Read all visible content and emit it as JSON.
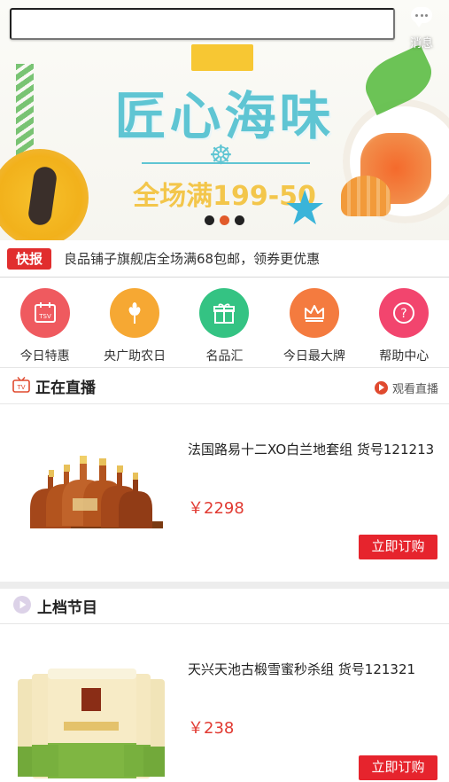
{
  "header": {
    "search_placeholder": "",
    "message_label": "消息"
  },
  "banner": {
    "title": "匠心海味",
    "promo": "全场满199-50",
    "dots": 3,
    "active_dot": 1,
    "colors": {
      "title": "#5fc5d3",
      "promo": "#f3c64b"
    }
  },
  "ticker": {
    "tag": "快报",
    "text": "良品铺子旗舰店全场满68包邮，领券更优惠"
  },
  "categories": [
    {
      "label": "今日特惠",
      "icon": "tsv-calendar-icon",
      "color": "#ef5a5f"
    },
    {
      "label": "央广助农日",
      "icon": "wheat-icon",
      "color": "#f6a833"
    },
    {
      "label": "名品汇",
      "icon": "gift-icon",
      "color": "#34c383"
    },
    {
      "label": "今日最大牌",
      "icon": "crown-icon",
      "color": "#f47b3f"
    },
    {
      "label": "帮助中心",
      "icon": "help-icon",
      "color": "#f2456e"
    }
  ],
  "live": {
    "title": "正在直播",
    "watch_label": "观看直播",
    "product": {
      "name": "法国路易十二XO白兰地套组 货号121213",
      "price": "￥2298",
      "buy_label": "立即订购"
    }
  },
  "upcoming": {
    "title": "上档节目",
    "product": {
      "name": "天兴天池古椴雪蜜秒杀组 货号121321",
      "price": "￥238",
      "buy_label": "立即订购"
    }
  }
}
